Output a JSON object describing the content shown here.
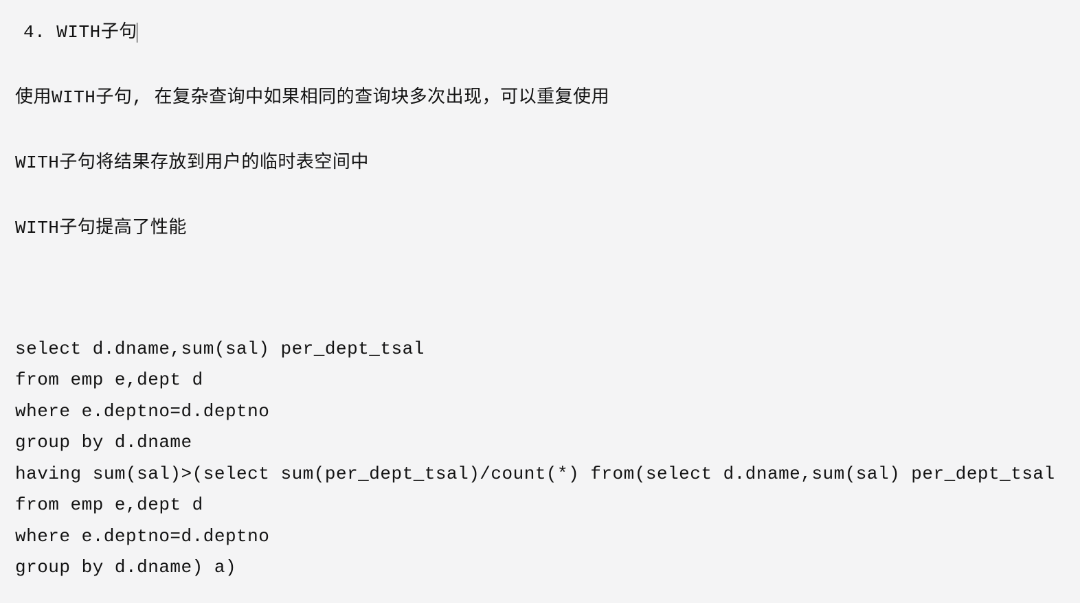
{
  "heading": "4. WITH子句",
  "paragraphs": [
    "使用WITH子句, 在复杂查询中如果相同的查询块多次出现，可以重复使用",
    "WITH子句将结果存放到用户的临时表空间中",
    "WITH子句提高了性能"
  ],
  "code_lines": [
    "select d.dname,sum(sal) per_dept_tsal",
    "from emp e,dept d",
    "where e.deptno=d.deptno",
    "group by d.dname",
    "having sum(sal)>(select sum(per_dept_tsal)/count(*) from(select d.dname,sum(sal) per_dept_tsal",
    "from emp e,dept d",
    "where e.deptno=d.deptno",
    "group by d.dname) a)"
  ]
}
